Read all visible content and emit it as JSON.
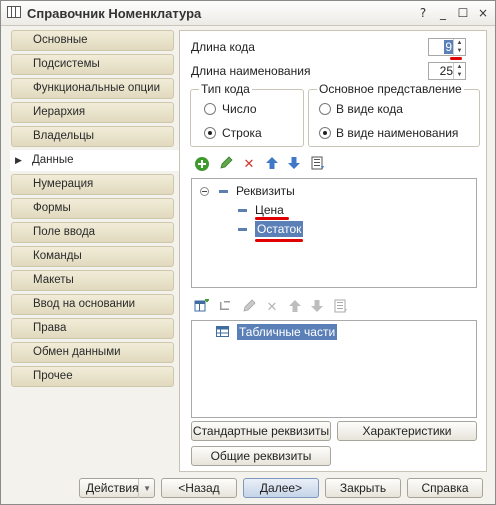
{
  "window": {
    "title": "Справочник Номенклатура",
    "controls": [
      "?",
      "_",
      "☐",
      "×"
    ]
  },
  "sidebar": {
    "items": [
      {
        "label": "Основные"
      },
      {
        "label": "Подсистемы"
      },
      {
        "label": "Функциональные опции"
      },
      {
        "label": "Иерархия"
      },
      {
        "label": "Владельцы"
      },
      {
        "label": "Данные",
        "active": true
      },
      {
        "label": "Нумерация"
      },
      {
        "label": "Формы"
      },
      {
        "label": "Поле ввода"
      },
      {
        "label": "Команды"
      },
      {
        "label": "Макеты"
      },
      {
        "label": "Ввод на основании"
      },
      {
        "label": "Права"
      },
      {
        "label": "Обмен данными"
      },
      {
        "label": "Прочее"
      }
    ]
  },
  "fields": {
    "code_length_label": "Длина кода",
    "code_length_value": "9",
    "name_length_label": "Длина наименования",
    "name_length_value": "25"
  },
  "code_type": {
    "title": "Тип кода",
    "options": [
      "Число",
      "Строка"
    ],
    "selected": "Строка"
  },
  "main_presentation": {
    "title": "Основное представление",
    "options": [
      "В виде кода",
      "В виде наименования"
    ],
    "selected": "В виде наименования"
  },
  "attributes_tree": {
    "root": "Реквизиты",
    "items": [
      "Цена",
      "Остаток"
    ],
    "selected": "Остаток"
  },
  "tabular_tree": {
    "root": "Табличные части"
  },
  "buttons": {
    "standard_attributes": "Стандартные реквизиты",
    "characteristics": "Характеристики",
    "common_attributes": "Общие реквизиты"
  },
  "footer": {
    "actions": "Действия",
    "back": "<Назад",
    "next": "Далее>",
    "close": "Закрыть",
    "help": "Справка"
  },
  "colors": {
    "selection": "#5b80b8",
    "annotation_red": "#e00000",
    "add_green": "#3e9a2e",
    "delete_red": "#d0342c",
    "move_blue": "#3f78c6"
  },
  "icons": {
    "attr_toolbar": [
      "add-icon",
      "edit-pencil-icon",
      "delete-icon",
      "move-up-icon",
      "move-down-icon",
      "sort-list-icon"
    ],
    "tab_toolbar": [
      "add-table-icon",
      "add-subitem-icon",
      "edit-pencil-icon",
      "delete-icon",
      "move-up-icon",
      "move-down-icon",
      "sort-list-icon"
    ]
  }
}
